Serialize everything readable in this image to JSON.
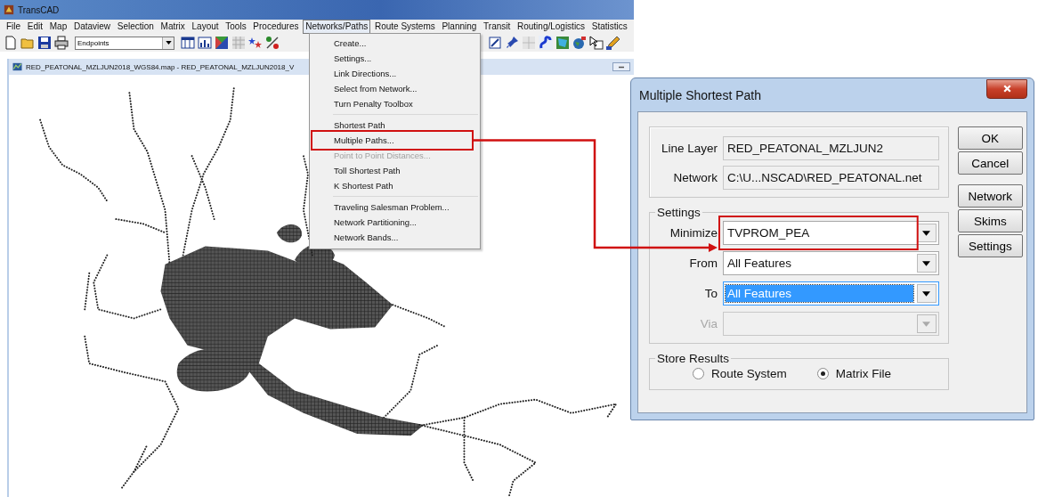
{
  "app": {
    "title": "TransCAD",
    "menus": [
      {
        "label": "File",
        "selected": false
      },
      {
        "label": "Edit",
        "selected": false
      },
      {
        "label": "Map",
        "selected": false
      },
      {
        "label": "Dataview",
        "selected": false
      },
      {
        "label": "Selection",
        "selected": false
      },
      {
        "label": "Matrix",
        "selected": false
      },
      {
        "label": "Layout",
        "selected": false
      },
      {
        "label": "Tools",
        "selected": false
      },
      {
        "label": "Procedures",
        "selected": false
      },
      {
        "label": "Networks/Paths",
        "selected": true
      },
      {
        "label": "Route Systems",
        "selected": false
      },
      {
        "label": "Planning",
        "selected": false
      },
      {
        "label": "Transit",
        "selected": false
      },
      {
        "label": "Routing/Logistics",
        "selected": false
      },
      {
        "label": "Statistics",
        "selected": false
      }
    ],
    "layer_select": "Endpoints",
    "map_window_title": "RED_PEATONAL_MZLJUN2018_WGS84.map - RED_PEATONAL_MZLJUN2018_V"
  },
  "menu": {
    "groups": [
      {
        "items": [
          {
            "label": "Create...",
            "disabled": false,
            "annotated": false
          },
          {
            "label": "Settings...",
            "disabled": false,
            "annotated": false
          },
          {
            "label": "Link Directions...",
            "disabled": false,
            "annotated": false
          },
          {
            "label": "Select from Network...",
            "disabled": false,
            "annotated": false
          },
          {
            "label": "Turn Penalty Toolbox",
            "disabled": false,
            "annotated": false
          }
        ]
      },
      {
        "items": [
          {
            "label": "Shortest Path",
            "disabled": false,
            "annotated": false
          },
          {
            "label": "Multiple Paths...",
            "disabled": false,
            "annotated": true
          },
          {
            "label": "Point to Point Distances...",
            "disabled": true,
            "annotated": false
          },
          {
            "label": "Toll Shortest Path",
            "disabled": false,
            "annotated": false
          },
          {
            "label": "K Shortest Path",
            "disabled": false,
            "annotated": false
          }
        ]
      },
      {
        "items": [
          {
            "label": "Traveling Salesman Problem...",
            "disabled": false,
            "annotated": false
          },
          {
            "label": "Network Partitioning...",
            "disabled": false,
            "annotated": false
          },
          {
            "label": "Network Bands...",
            "disabled": false,
            "annotated": false
          }
        ]
      }
    ]
  },
  "dialog": {
    "title": "Multiple Shortest Path",
    "fields": [
      {
        "label": "Line Layer",
        "value": "RED_PEATONAL_MZLJUN2"
      },
      {
        "label": "Network",
        "value": "C:\\U...NSCAD\\RED_PEATONAL.net"
      }
    ],
    "settings": {
      "title": "Settings",
      "rows": [
        {
          "label": "Minimize",
          "value": "TVPROM_PEA",
          "disabled": false,
          "focused": false,
          "annotated": true
        },
        {
          "label": "From",
          "value": "All Features",
          "disabled": false,
          "focused": false,
          "annotated": false
        },
        {
          "label": "To",
          "value": "All Features",
          "disabled": false,
          "focused": true,
          "annotated": false
        },
        {
          "label": "Via",
          "disabled": true,
          "annotated": false
        }
      ]
    },
    "store_results": {
      "title": "Store Results",
      "options": [
        {
          "label": "Route System",
          "selected": false
        },
        {
          "label": "Matrix File",
          "selected": true
        }
      ]
    },
    "button_groups": [
      {
        "buttons": [
          "OK",
          "Cancel"
        ]
      },
      {
        "buttons": [
          "Network",
          "Skims",
          "Settings"
        ]
      }
    ]
  }
}
